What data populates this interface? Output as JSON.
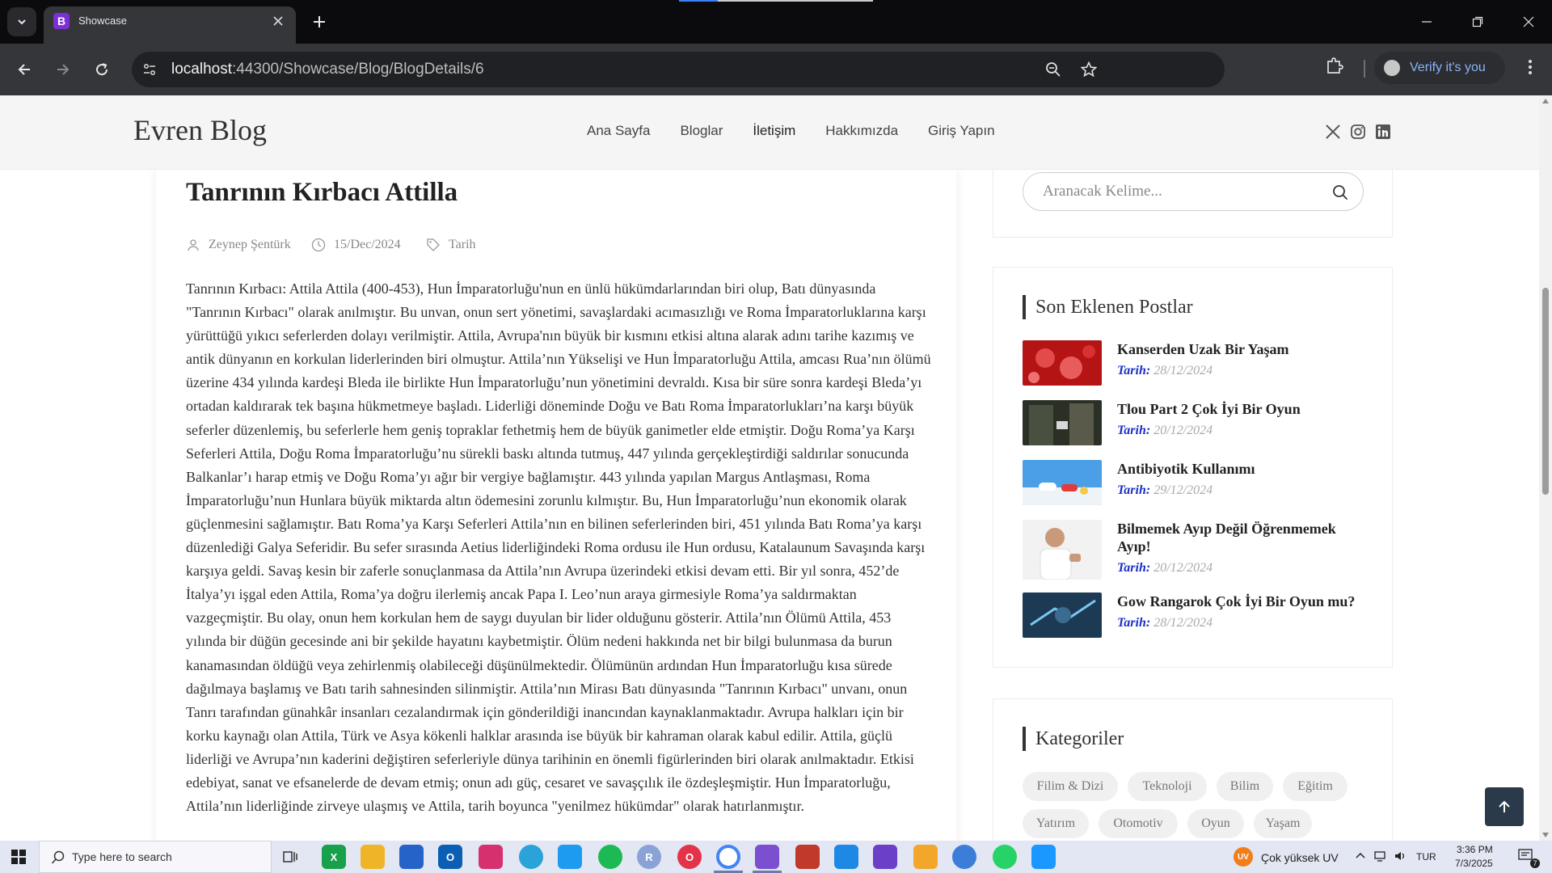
{
  "browser": {
    "tab_title": "Showcase",
    "tab_favicon": "B",
    "url_host": "localhost",
    "url_rest": ":44300/Showcase/Blog/BlogDetails/6",
    "profile_label": "Verify it's you"
  },
  "site": {
    "brand": "Evren Blog",
    "nav": [
      "Ana Sayfa",
      "Bloglar",
      "İletişim",
      "Hakkımızda",
      "Giriş Yapın"
    ]
  },
  "article": {
    "title": "Tanrının Kırbacı Attilla",
    "author": "Zeynep Şentürk",
    "date": "15/Dec/2024",
    "category": "Tarih",
    "body": "Tanrının Kırbacı: Attila Attila (400-453), Hun İmparatorluğu'nun en ünlü hükümdarlarından biri olup, Batı dünyasında \"Tanrının Kırbacı\" olarak anılmıştır. Bu unvan, onun sert yönetimi, savaşlardaki acımasızlığı ve Roma İmparatorluklarına karşı yürüttüğü yıkıcı seferlerden dolayı verilmiştir. Attila, Avrupa'nın büyük bir kısmını etkisi altına alarak adını tarihe kazımış ve antik dünyanın en korkulan liderlerinden biri olmuştur. Attila’nın Yükselişi ve Hun İmparatorluğu Attila, amcası Rua’nın ölümü üzerine 434 yılında kardeşi Bleda ile birlikte Hun İmparatorluğu’nun yönetimini devraldı. Kısa bir süre sonra kardeşi Bleda’yı ortadan kaldırarak tek başına hükmetmeye başladı. Liderliği döneminde Doğu ve Batı Roma İmparatorlukları’na karşı büyük seferler düzenlemiş, bu seferlerle hem geniş topraklar fethetmiş hem de büyük ganimetler elde etmiştir. Doğu Roma’ya Karşı Seferleri Attila, Doğu Roma İmparatorluğu’nu sürekli baskı altında tutmuş, 447 yılında gerçekleştirdiği saldırılar sonucunda Balkanlar’ı harap etmiş ve Doğu Roma’yı ağır bir vergiye bağlamıştır. 443 yılında yapılan Margus Antlaşması, Roma İmparatorluğu’nun Hunlara büyük miktarda altın ödemesini zorunlu kılmıştır. Bu, Hun İmparatorluğu’nun ekonomik olarak güçlenmesini sağlamıştır. Batı Roma’ya Karşı Seferleri Attila’nın en bilinen seferlerinden biri, 451 yılında Batı Roma’ya karşı düzenlediği Galya Seferidir. Bu sefer sırasında Aetius liderliğindeki Roma ordusu ile Hun ordusu, Katalaunum Savaşında karşı karşıya geldi. Savaş kesin bir zaferle sonuçlanmasa da Attila’nın Avrupa üzerindeki etkisi devam etti. Bir yıl sonra, 452’de İtalya’yı işgal eden Attila, Roma’ya doğru ilerlemiş ancak Papa I. Leo’nun araya girmesiyle Roma’ya saldırmaktan vazgeçmiştir. Bu olay, onun hem korkulan hem de saygı duyulan bir lider olduğunu gösterir. Attila’nın Ölümü Attila, 453 yılında bir düğün gecesinde ani bir şekilde hayatını kaybetmiştir. Ölüm nedeni hakkında net bir bilgi bulunmasa da burun kanamasından öldüğü veya zehirlenmiş olabileceği düşünülmektedir. Ölümünün ardından Hun İmparatorluğu kısa sürede dağılmaya başlamış ve Batı tarih sahnesinden silinmiştir. Attila’nın Mirası Batı dünyasında \"Tanrının Kırbacı\" unvanı, onun Tanrı tarafından günahkâr insanları cezalandırmak için gönderildiği inancından kaynaklanmaktadır. Avrupa halkları için bir korku kaynağı olan Attila, Türk ve Asya kökenli halklar arasında ise büyük bir kahraman olarak kabul edilir. Attila, güçlü liderliği ve Avrupa’nın kaderini değiştiren seferleriyle dünya tarihinin en önemli figürlerinden biri olarak anılmaktadır. Etkisi edebiyat, sanat ve efsanelerde de devam etmiş; onun adı güç, cesaret ve savaşçılık ile özdeşleşmiştir. Hun İmparatorluğu, Attila’nın liderliğinde zirveye ulaşmış ve Attila, tarih boyunca \"yenilmez hükümdar\" olarak hatırlanmıştır."
  },
  "sidebar": {
    "search_placeholder": "Aranacak Kelime...",
    "recent_heading": "Son Eklenen Postlar",
    "date_label": "Tarih:",
    "recent_posts": [
      {
        "title": "Kanserden Uzak Bir Yaşam",
        "date": "28/12/2024"
      },
      {
        "title": "Tlou Part 2 Çok İyi Bir Oyun",
        "date": "20/12/2024"
      },
      {
        "title": "Antibiyotik Kullanımı",
        "date": "29/12/2024"
      },
      {
        "title": "Bilmemek Ayıp Değil Öğrenmemek Ayıp!",
        "date": "20/12/2024"
      },
      {
        "title": "Gow Rangarok Çok İyi Bir Oyun mu?",
        "date": "28/12/2024"
      }
    ],
    "categories_heading": "Kategoriler",
    "categories": [
      "Filim & Dizi",
      "Teknoloji",
      "Bilim",
      "Eğitim",
      "Yatırım",
      "Otomotiv",
      "Oyun",
      "Yaşam"
    ]
  },
  "taskbar": {
    "search_placeholder": "Type here to search",
    "weather": "Çok yüksek UV",
    "weather_badge": "UV",
    "language": "TUR",
    "time": "3:36 PM",
    "date": "7/3/2025",
    "notification_count": "7"
  },
  "colors": {
    "date_label": "#1a2fc9",
    "scroll_top_bg": "#2b3a4a",
    "tab_favicon_bg": "#7b2fd6"
  }
}
